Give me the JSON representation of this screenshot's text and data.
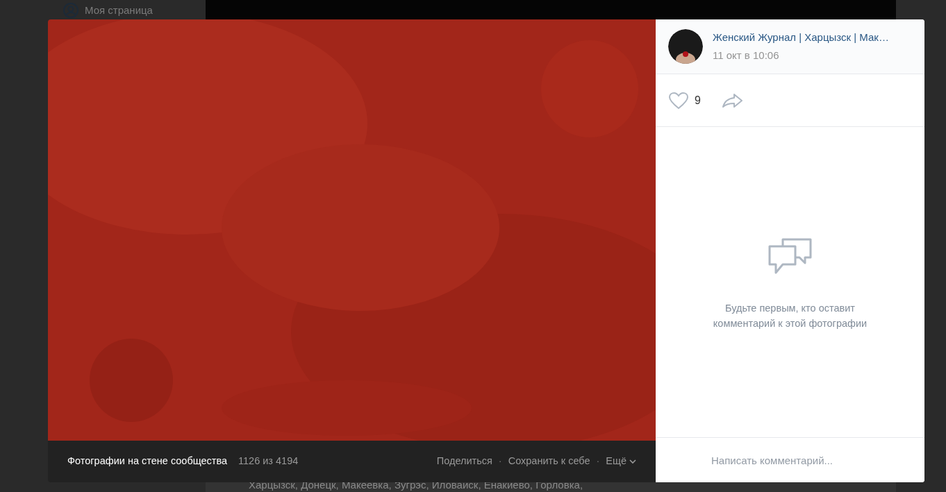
{
  "background_page": {
    "menu_item": "Моя страница",
    "post_text": "Харцызск, Донецк, Макеевка, Зугрэс, Иловайск, Енакиево, Горловка,"
  },
  "viewer": {
    "bottom_bar": {
      "album": "Фотографии на стене сообщества",
      "counter": "1126 из 4194",
      "actions": [
        "Поделиться",
        "Сохранить к себе",
        "Ещё"
      ],
      "separator": "·"
    },
    "author": {
      "name": "Женский Журнал | Харцызск | Мак…",
      "date": "11 окт в 10:06"
    },
    "likes": {
      "count": "9",
      "liked": false
    },
    "empty_comments": "Будьте первым, кто оставит комментарий к этой фотографии",
    "comment_field": {
      "placeholder": "Написать комментарий..."
    }
  }
}
